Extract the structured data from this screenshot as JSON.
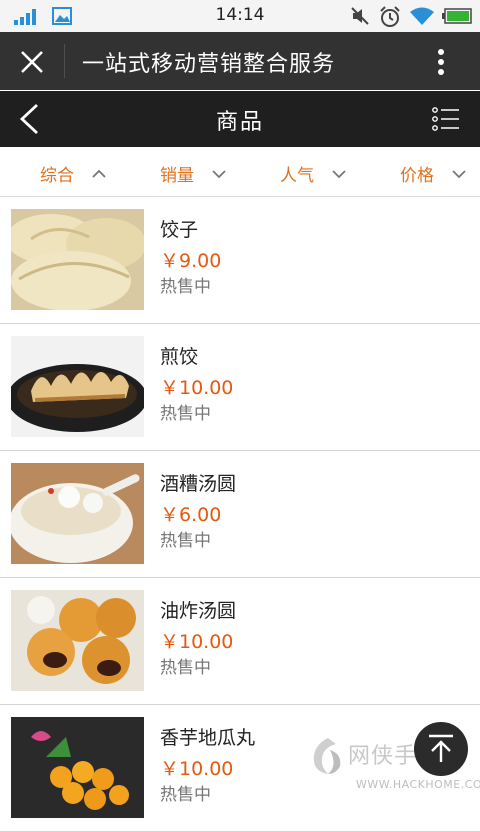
{
  "status_bar": {
    "time": "14:14"
  },
  "title_bar": {
    "title": "一站式移动营销整合服务"
  },
  "nav_bar": {
    "title": "商品"
  },
  "sort_bar": {
    "items": [
      {
        "label": "综合",
        "arrow": "up"
      },
      {
        "label": "销量",
        "arrow": "down"
      },
      {
        "label": "人气",
        "arrow": "down"
      },
      {
        "label": "价格",
        "arrow": "down"
      }
    ]
  },
  "products": [
    {
      "name": "饺子",
      "price": "￥9.00",
      "status": "热售中"
    },
    {
      "name": "煎饺",
      "price": "￥10.00",
      "status": "热售中"
    },
    {
      "name": "酒糟汤圆",
      "price": "￥6.00",
      "status": "热售中"
    },
    {
      "name": "油炸汤圆",
      "price": "￥10.00",
      "status": "热售中"
    },
    {
      "name": "香芋地瓜丸",
      "price": "￥10.00",
      "status": "热售中"
    }
  ],
  "watermark": {
    "name": "网侠手机站",
    "url": "WWW.HACKHOME.COM"
  },
  "colors": {
    "accent": "#e0711f",
    "price": "#e35a10",
    "titlebar": "#323232",
    "navbar": "#1f1f1f"
  }
}
